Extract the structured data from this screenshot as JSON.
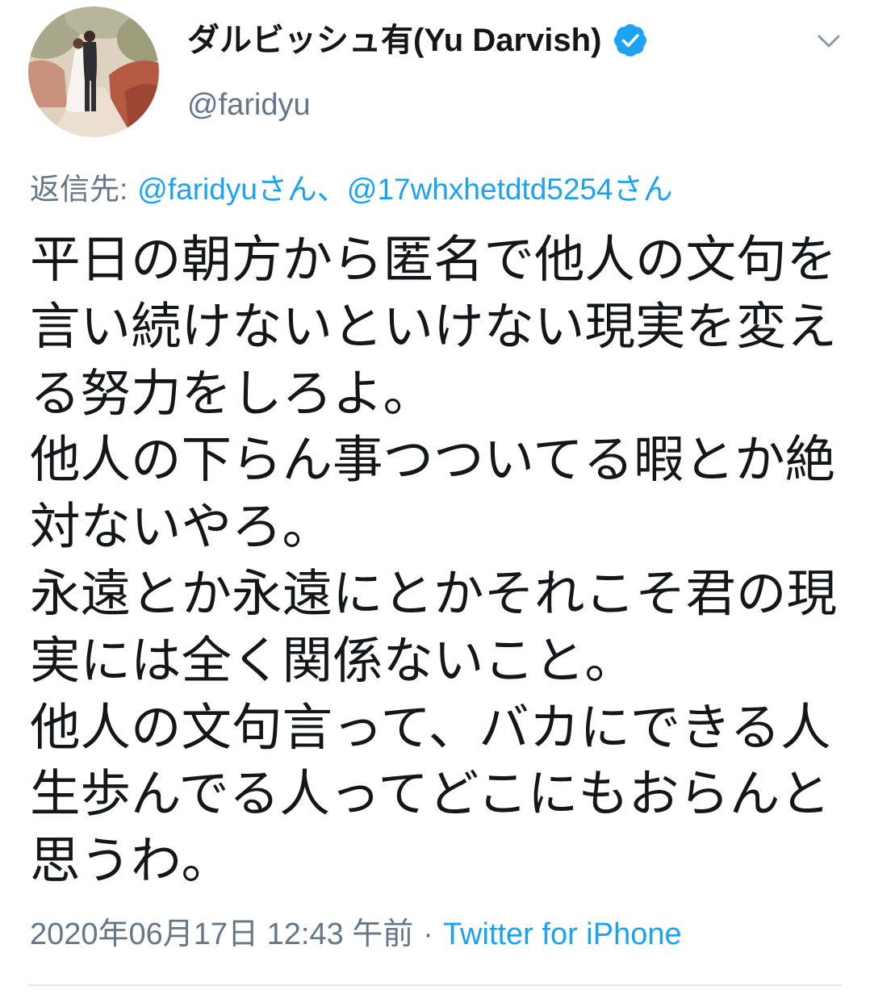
{
  "colors": {
    "text": "#14171A",
    "secondary": "#657786",
    "link": "#1DA1F2",
    "divider": "#E1E8ED",
    "icon": "#8899A6"
  },
  "icons": {
    "verified": "verified-badge-icon",
    "menu": "chevron-down-icon",
    "avatar": "avatar"
  },
  "author": {
    "display_name": "ダルビッシュ有(Yu Darvish)",
    "handle": "@faridyu",
    "verified": true
  },
  "reply_to": {
    "prefix": "返信先:",
    "mentions": [
      "@faridyuさん",
      "@17whxhetdtd5254さん"
    ],
    "separator": "、"
  },
  "text": {
    "paragraphs": [
      {
        "lines": [
          "平日の朝方から匿名で他人の文句を",
          "言い続けないといけない現実を変え",
          "る努力をしろよ。"
        ]
      },
      {
        "lines": [
          "他人の下らん事つついてる暇とか絶",
          "対ないやろ。"
        ]
      },
      {
        "lines": [
          "永遠とか永遠にとかそれこそ君の現",
          "実には全く関係ないこと。"
        ]
      },
      {
        "lines": [
          "他人の文句言って、バカにできる人",
          "生歩んでる人ってどこにもおらんと",
          "思うわ。"
        ]
      }
    ]
  },
  "meta": {
    "timestamp": "2020年06月17日 12:43 午前",
    "separator": "·",
    "source": "Twitter for iPhone"
  }
}
